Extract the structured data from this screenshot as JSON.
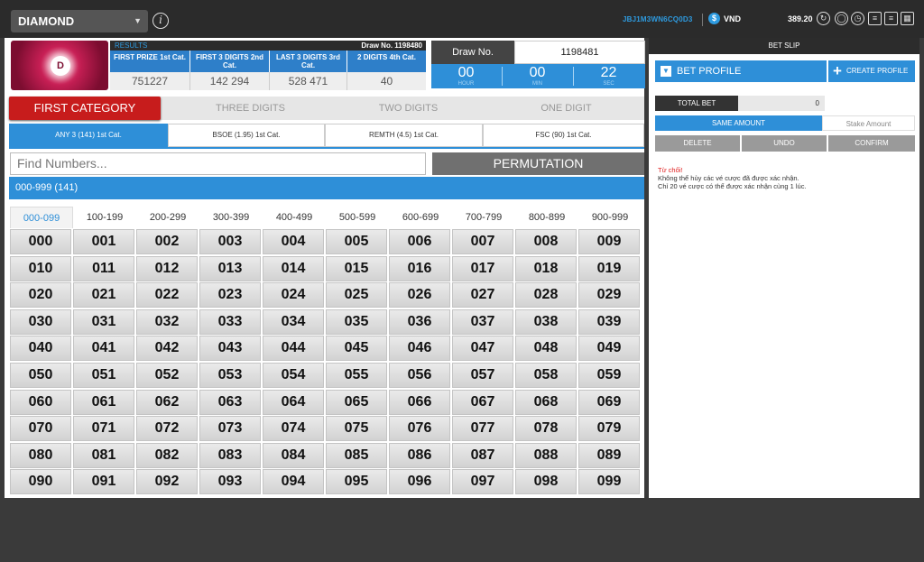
{
  "topbar": {
    "game": "DIAMOND",
    "account": "JBJ1M3WN6CQ0D3",
    "currency": "VND",
    "currency_symbol": "$",
    "balance": "389.20"
  },
  "results": {
    "label": "RESULTS",
    "draw": "Draw No. 1198480",
    "columns": [
      {
        "title": "FIRST PRIZE 1st Cat.",
        "value": "751227"
      },
      {
        "title": "FIRST 3 DIGITS 2nd Cat.",
        "value": "142   294"
      },
      {
        "title": "LAST 3 DIGITS 3rd Cat.",
        "value": "528   471"
      },
      {
        "title": "2 DIGITS 4th Cat.",
        "value": "40"
      }
    ]
  },
  "draw": {
    "label": "Draw No.",
    "value": "1198481",
    "timer": [
      {
        "value": "00",
        "unit": "HOUR"
      },
      {
        "value": "00",
        "unit": "MIN"
      },
      {
        "value": "22",
        "unit": "SEC"
      }
    ]
  },
  "category_tabs": [
    "FIRST CATEGORY",
    "THREE DIGITS",
    "TWO DIGITS",
    "ONE DIGIT"
  ],
  "sub_tabs": [
    "ANY 3 (141) 1st Cat.",
    "BSOE (1.95) 1st Cat.",
    "REMTH (4.5) 1st Cat.",
    "FSC (90) 1st Cat."
  ],
  "search": {
    "placeholder": "Find Numbers..."
  },
  "permutation_label": "PERMUTATION",
  "range_bar": "000-999 (141)",
  "range_tabs": [
    "000-099",
    "100-199",
    "200-299",
    "300-399",
    "400-499",
    "500-599",
    "600-699",
    "700-799",
    "800-899",
    "900-999"
  ],
  "numbers": [
    [
      "000",
      "001",
      "002",
      "003",
      "004",
      "005",
      "006",
      "007",
      "008",
      "009"
    ],
    [
      "010",
      "011",
      "012",
      "013",
      "014",
      "015",
      "016",
      "017",
      "018",
      "019"
    ],
    [
      "020",
      "021",
      "022",
      "023",
      "024",
      "025",
      "026",
      "027",
      "028",
      "029"
    ],
    [
      "030",
      "031",
      "032",
      "033",
      "034",
      "035",
      "036",
      "037",
      "038",
      "039"
    ],
    [
      "040",
      "041",
      "042",
      "043",
      "044",
      "045",
      "046",
      "047",
      "048",
      "049"
    ],
    [
      "050",
      "051",
      "052",
      "053",
      "054",
      "055",
      "056",
      "057",
      "058",
      "059"
    ],
    [
      "060",
      "061",
      "062",
      "063",
      "064",
      "065",
      "066",
      "067",
      "068",
      "069"
    ],
    [
      "070",
      "071",
      "072",
      "073",
      "074",
      "075",
      "076",
      "077",
      "078",
      "079"
    ],
    [
      "080",
      "081",
      "082",
      "083",
      "084",
      "085",
      "086",
      "087",
      "088",
      "089"
    ],
    [
      "090",
      "091",
      "092",
      "093",
      "094",
      "095",
      "096",
      "097",
      "098",
      "099"
    ]
  ],
  "betslip": {
    "title": "BET SLIP",
    "bet_profile": "BET PROFILE",
    "create_profile": "CREATE PROFILE",
    "total_bet_label": "TOTAL BET",
    "total_bet_value": "0",
    "same_amount": "SAME AMOUNT",
    "stake_amount": "Stake Amount",
    "delete": "DELETE",
    "undo": "UNDO",
    "confirm": "CONFIRM",
    "warning_title": "Từ chối!",
    "warning_lines": [
      "Không thể hủy các vé cược đã được xác nhận.",
      "Chỉ 20 vé cược có thể được xác nhận cùng 1 lúc."
    ]
  },
  "colors": {
    "accent": "#2e8fd8",
    "danger": "#c71c1c",
    "brand": "#c81f55"
  }
}
